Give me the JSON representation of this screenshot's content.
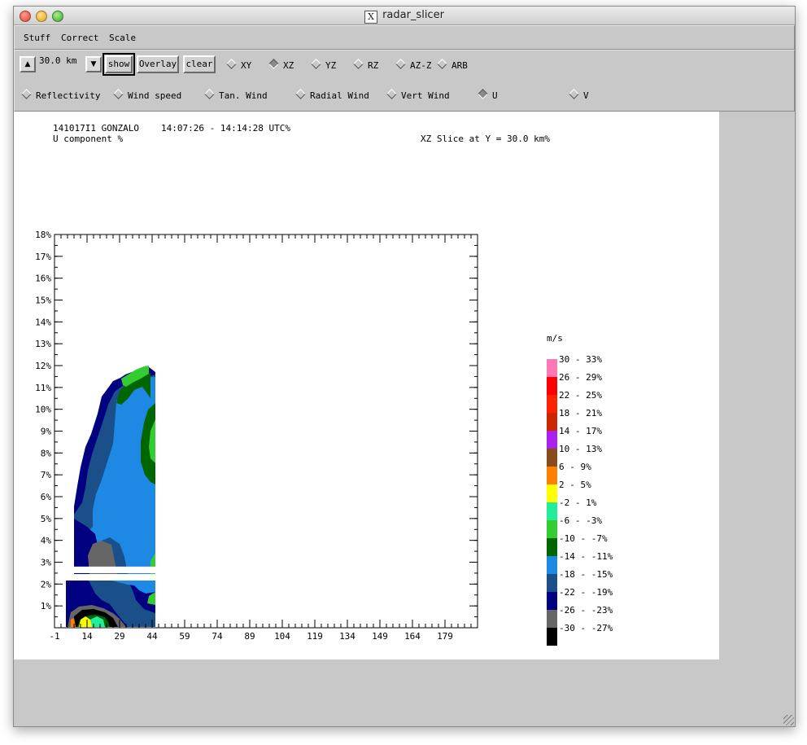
{
  "window": {
    "title": "radar_slicer"
  },
  "menu": [
    {
      "label": "Stuff"
    },
    {
      "label": "Correct"
    },
    {
      "label": "Scale"
    }
  ],
  "toolbar": {
    "level_value": "30.0 km",
    "show_label": "show",
    "overlay_label": "Overlay",
    "clear_label": "clear",
    "slice_options": [
      {
        "label": "XY",
        "selected": false
      },
      {
        "label": "XZ",
        "selected": true
      },
      {
        "label": "YZ",
        "selected": false
      },
      {
        "label": "RZ",
        "selected": false
      },
      {
        "label": "AZ-Z",
        "selected": false
      },
      {
        "label": "ARB",
        "selected": false
      }
    ],
    "field_options": [
      {
        "label": "Reflectivity",
        "selected": false
      },
      {
        "label": "Wind speed",
        "selected": false
      },
      {
        "label": "Tan. Wind",
        "selected": false
      },
      {
        "label": "Radial Wind",
        "selected": false
      },
      {
        "label": "Vert Wind",
        "selected": false
      },
      {
        "label": "U",
        "selected": true
      },
      {
        "label": "V",
        "selected": false
      }
    ]
  },
  "plot": {
    "header_id": "141017I1 GONZALO",
    "header_time": "14:07:26 - 14:14:28 UTC%",
    "header_field": "U component %",
    "header_slice": "XZ Slice at Y = 30.0 km%"
  },
  "chart_data": {
    "type": "heatmap",
    "title": "",
    "xlabel": "",
    "ylabel": "",
    "xlim": [
      -1,
      194
    ],
    "ylim": [
      0,
      18
    ],
    "x_tick_labels": [
      "-1",
      "14",
      "29",
      "44",
      "59",
      "74",
      "89",
      "104",
      "119",
      "134",
      "149",
      "164",
      "179"
    ],
    "y_tick_labels": [
      "18%",
      "17%",
      "16%",
      "15%",
      "14%",
      "13%",
      "12%",
      "11%",
      "10%",
      "9%",
      "8%",
      "7%",
      "6%",
      "5%",
      "4%",
      "3%",
      "2%",
      "1%"
    ],
    "legend": {
      "title": "m/s",
      "placement": "right",
      "bins": [
        {
          "label": "30 - 33%",
          "color": "#ff77b4"
        },
        {
          "label": "26 - 29%",
          "color": "#ff0000"
        },
        {
          "label": "22 - 25%",
          "color": "#ff2200"
        },
        {
          "label": "18 - 21%",
          "color": "#cc2800"
        },
        {
          "label": "14 - 17%",
          "color": "#aa22ee"
        },
        {
          "label": "10 - 13%",
          "color": "#8a4a1a"
        },
        {
          "label": "6 - 9%",
          "color": "#ff7f00"
        },
        {
          "label": "2 - 5%",
          "color": "#ffff00"
        },
        {
          "label": "-2 - 1%",
          "color": "#22ee99"
        },
        {
          "label": "-6 - -3%",
          "color": "#33cc33"
        },
        {
          "label": "-10 - -7%",
          "color": "#006600"
        },
        {
          "label": "-14 - -11%",
          "color": "#1e88e5"
        },
        {
          "label": "-18 - -15%",
          "color": "#1a4f8a"
        },
        {
          "label": "-22 - -19%",
          "color": "#000080"
        },
        {
          "label": "-26 - -23%",
          "color": "#666666"
        },
        {
          "label": "-30 - -27%",
          "color": "#000000"
        }
      ]
    },
    "data_coverage": {
      "x_range": [
        8,
        46
      ],
      "z_range": [
        0,
        12.1
      ],
      "gap_z_range": [
        2.5,
        2.8
      ]
    }
  }
}
